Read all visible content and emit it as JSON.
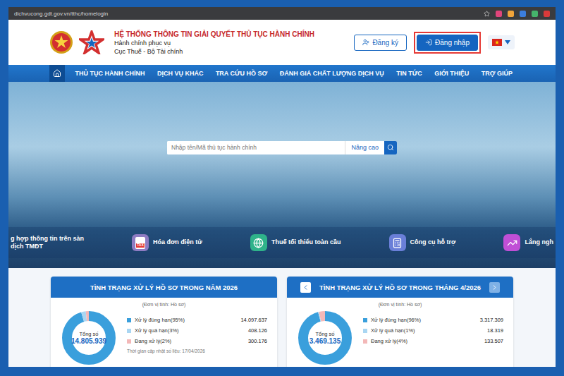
{
  "browser": {
    "url": "dichvucong.gdt.gov.vn/tthc/homelogin"
  },
  "header": {
    "title": "HỆ THỐNG THÔNG TIN GIẢI QUYẾT THỦ TỤC HÀNH CHÍNH",
    "subtitle": "Hành chính phục vụ",
    "agency": "Cục Thuế - Bộ Tài chính"
  },
  "auth_buttons": [
    {
      "label": "Đăng ký",
      "kind": "outline",
      "highlighted": false
    },
    {
      "label": "Đăng nhập",
      "kind": "primary",
      "highlighted": true
    }
  ],
  "nav": {
    "home_selected": true,
    "items": [
      {
        "label": "THỦ TỤC HÀNH CHÍNH",
        "selected": false
      },
      {
        "label": "DỊCH VỤ KHÁC",
        "selected": false
      },
      {
        "label": "TRA CỨU HỒ SƠ",
        "selected": false
      },
      {
        "label": "ĐÁNH GIÁ CHẤT LƯỢNG DỊCH VỤ",
        "selected": false
      },
      {
        "label": "TIN TỨC",
        "selected": false
      },
      {
        "label": "GIỚI THIỆU",
        "selected": false
      },
      {
        "label": "TRỢ GIÚP",
        "selected": false
      }
    ]
  },
  "search": {
    "placeholder": "Nhập tên/Mã thủ tục hành chính",
    "advanced": "Nâng cao"
  },
  "quick_links": [
    {
      "lines": [
        "g hợp thông tin trên sàn",
        "dịch TMĐT"
      ],
      "kind": "text"
    },
    {
      "lines": [
        "Hóa đơn điện tử"
      ],
      "kind": "tax",
      "icon_text": "TAX"
    },
    {
      "lines": [
        "Thuế tối thiểu toàn cầu"
      ],
      "kind": "globe"
    },
    {
      "lines": [
        "Công cụ hỗ trợ"
      ],
      "kind": "calc"
    },
    {
      "lines": [
        "Lắng ngh"
      ],
      "kind": "trend"
    }
  ],
  "stats": [
    {
      "title": "TÌNH TRẠNG XỬ LÝ HỒ SƠ TRONG NĂM 2026",
      "has_nav": false,
      "unit": "(Đơn vị tính: Hồ sơ)",
      "total_label": "Tổng số",
      "total": "14.805.939",
      "values": [
        14097637,
        408126,
        300176
      ],
      "items": [
        {
          "label": "Xử lý đúng hạn(95%)",
          "value": "14.097.637",
          "color": "#3a9fdc"
        },
        {
          "label": "Xử lý quá hạn(3%)",
          "value": "408.126",
          "color": "#a9d6f2"
        },
        {
          "label": "Đang xử lý(2%)",
          "value": "300.176",
          "color": "#f3b8b8"
        }
      ],
      "updated": "Thời gian cập nhật số liệu: 17/04/2026"
    },
    {
      "title": "TÌNH TRẠNG XỬ LÝ HỒ SƠ TRONG THÁNG 4/2026",
      "has_nav": true,
      "unit": "(Đơn vị tính: Hồ sơ)",
      "total_label": "Tổng số",
      "total": "3.469.135",
      "values": [
        3317309,
        18319,
        133507
      ],
      "items": [
        {
          "label": "Xử lý đúng hạn(96%)",
          "value": "3.317.309",
          "color": "#3a9fdc"
        },
        {
          "label": "Xử lý quá hạn(1%)",
          "value": "18.319",
          "color": "#a9d6f2"
        },
        {
          "label": "Đang xử lý(4%)",
          "value": "133.507",
          "color": "#f3b8b8"
        }
      ],
      "updated": ""
    }
  ]
}
